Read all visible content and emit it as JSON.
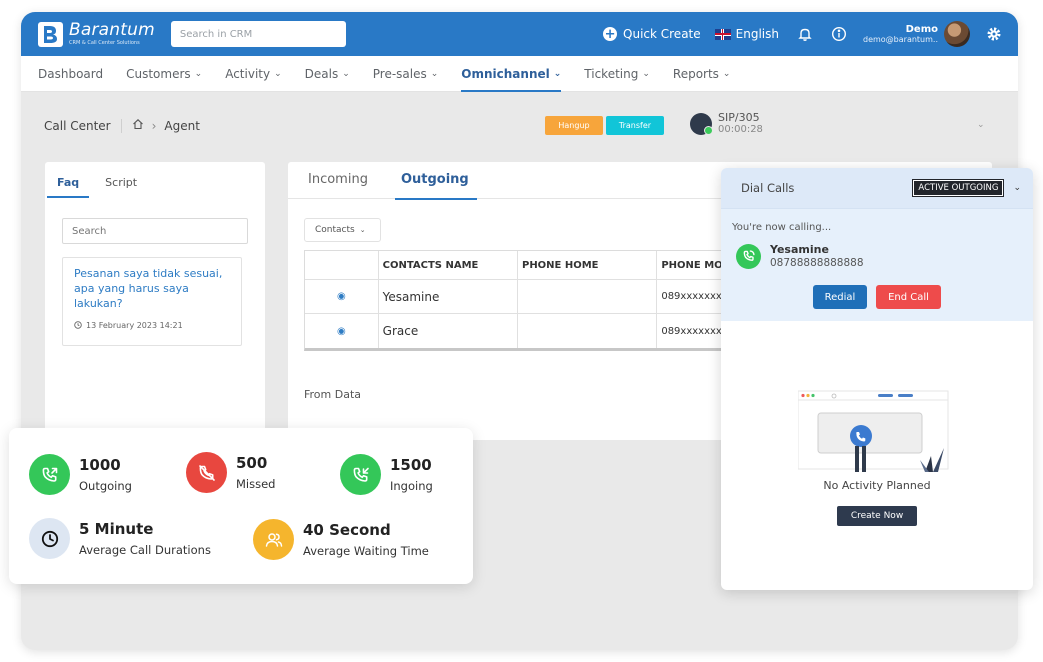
{
  "app": {
    "name": "Barantum",
    "tagline": "CRM & Call Center Solutions"
  },
  "topbar": {
    "search_placeholder": "Search in CRM",
    "quick_create": "Quick Create",
    "language": "English",
    "user_name": "Demo",
    "user_email": "demo@barantum.."
  },
  "nav": [
    {
      "label": "Dashboard",
      "dropdown": false,
      "active": false
    },
    {
      "label": "Customers",
      "dropdown": true,
      "active": false
    },
    {
      "label": "Activity",
      "dropdown": true,
      "active": false
    },
    {
      "label": "Deals",
      "dropdown": true,
      "active": false
    },
    {
      "label": "Pre-sales",
      "dropdown": true,
      "active": false
    },
    {
      "label": "Omnichannel",
      "dropdown": true,
      "active": true
    },
    {
      "label": "Ticketing",
      "dropdown": true,
      "active": false
    },
    {
      "label": "Reports",
      "dropdown": true,
      "active": false
    }
  ],
  "breadcrumb": {
    "title": "Call Center",
    "current": "Agent"
  },
  "call_controls": {
    "hangup": "Hangup",
    "transfer": "Transfer",
    "sip_ext": "SIP/305",
    "duration": "00:00:28"
  },
  "faq": {
    "tabs": [
      "Faq",
      "Script"
    ],
    "search_placeholder": "Search",
    "item": {
      "question": "Pesanan saya tidak sesuai, apa yang harus saya lakukan?",
      "date": "13 February 2023 14:21"
    }
  },
  "main": {
    "tabs": [
      "Incoming",
      "Outgoing"
    ],
    "active_tab": "Outgoing",
    "contacts_dropdown": "Contacts",
    "columns": [
      "",
      "CONTACTS NAME",
      "PHONE HOME",
      "PHONE MO"
    ],
    "rows": [
      {
        "name": "Yesamine",
        "phone_home": "",
        "phone_mobile": "089xxxxxxx"
      },
      {
        "name": "Grace",
        "phone_home": "",
        "phone_mobile": "089xxxxxxx"
      }
    ],
    "from_data": "From Data"
  },
  "stats": [
    {
      "value": "1000",
      "label": "Outgoing",
      "color": "#34c759",
      "icon": "phone-outgoing-icon"
    },
    {
      "value": "500",
      "label": "Missed",
      "color": "#e8473f",
      "icon": "phone-missed-icon"
    },
    {
      "value": "1500",
      "label": "Ingoing",
      "color": "#34c759",
      "icon": "phone-incoming-icon"
    },
    {
      "value": "5 Minute",
      "label": "Average Call Durations",
      "color": "#dde6f2",
      "icon": "clock-icon"
    },
    {
      "value": "40 Second",
      "label": "Average Waiting Time",
      "color": "#f5b52d",
      "icon": "users-icon"
    }
  ],
  "dial_calls": {
    "title": "Dial Calls",
    "badge": "ACTIVE OUTGOING",
    "calling_text": "You're now calling...",
    "caller_name": "Yesamine",
    "caller_number": "08788888888888",
    "redial": "Redial",
    "end_call": "End Call",
    "empty_text": "No Activity Planned",
    "create_now": "Create Now"
  },
  "colors": {
    "brand": "#2979c6",
    "hangup": "#f7a53b",
    "transfer": "#11c5d8",
    "redial": "#1f6fb8",
    "end_call": "#ee4b4b"
  }
}
